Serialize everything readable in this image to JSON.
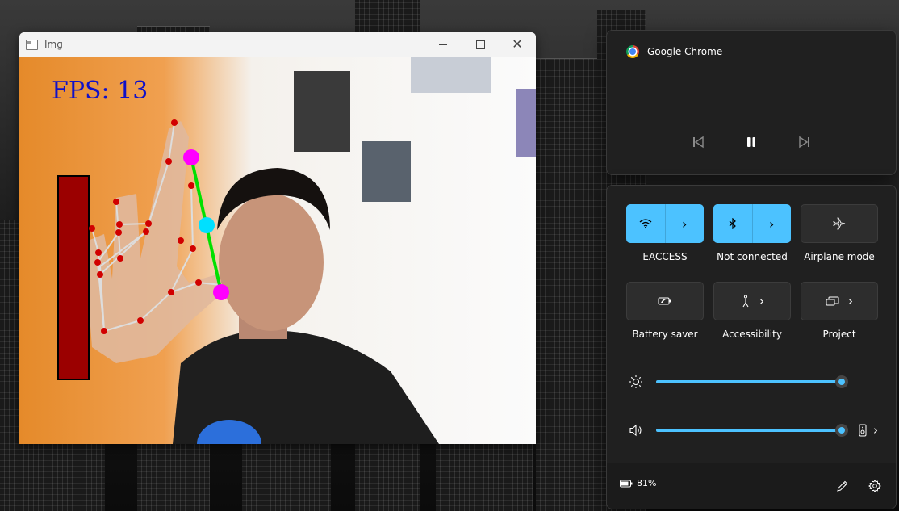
{
  "cv_window": {
    "title": "Img",
    "fps_text": "FPS: 13",
    "volume_level_percent": 100
  },
  "media": {
    "app_name": "Google Chrome",
    "icons": [
      "previous-icon",
      "pause-icon",
      "next-icon"
    ]
  },
  "quick_settings": {
    "tiles": [
      {
        "label": "EACCESS",
        "state": "on",
        "icon": "wifi-icon"
      },
      {
        "label": "Not connected",
        "state": "on",
        "icon": "bluetooth-icon"
      },
      {
        "label": "Airplane mode",
        "state": "off",
        "icon": "airplane-icon"
      },
      {
        "label": "Battery saver",
        "state": "off",
        "icon": "battery-saver-icon"
      },
      {
        "label": "Accessibility",
        "state": "off",
        "icon": "accessibility-icon"
      },
      {
        "label": "Project",
        "state": "off",
        "icon": "project-icon"
      }
    ],
    "brightness_percent": 100,
    "volume_percent": 100,
    "battery_text": "81%",
    "accent_color": "#4cc2ff"
  }
}
